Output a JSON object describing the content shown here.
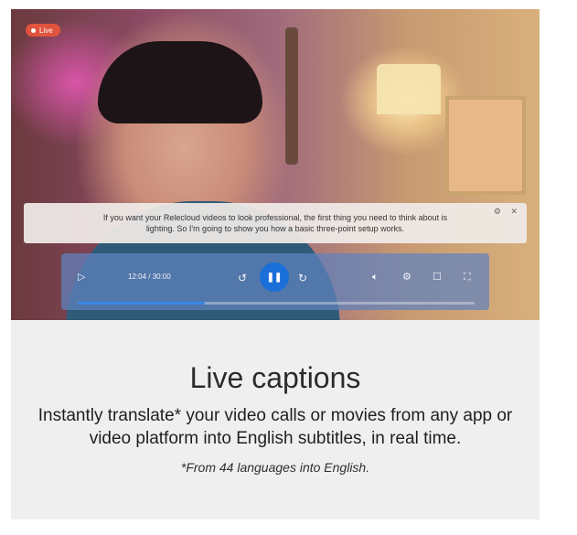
{
  "video": {
    "live_label": "Live",
    "caption_text": "If you want your Relecloud videos to look professional, the first thing you need to think about is lighting. So I'm going to show you how a basic three-point setup works.",
    "controls": {
      "time": "12:04 / 30:00",
      "progress_fraction": 0.32,
      "icons": [
        "play-icon",
        "rewind-10-icon",
        "pause-icon",
        "forward-10-icon",
        "volume-icon",
        "settings-icon",
        "miniplayer-icon",
        "fullscreen-icon"
      ]
    },
    "colors": {
      "live_badge": "#e0533d",
      "accent": "#1a6fd8"
    }
  },
  "promo": {
    "title": "Live captions",
    "description": "Instantly translate* your video calls or movies from any app or video platform into English subtitles, in real time.",
    "footnote": "*From 44 languages into English."
  }
}
